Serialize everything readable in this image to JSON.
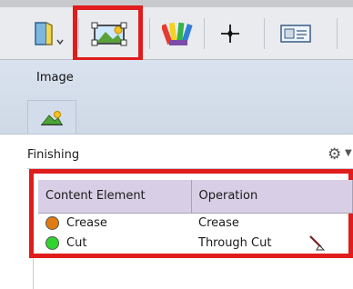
{
  "toolbar": {
    "tools": [
      {
        "icon": "document-flip-icon"
      },
      {
        "icon": "image-frame-icon",
        "selected": true
      },
      {
        "icon": "color-swatches-icon"
      },
      {
        "icon": "crosshair-icon"
      },
      {
        "icon": "layout-view-icon"
      }
    ]
  },
  "image_panel": {
    "label": "Image",
    "tab_icon": "image-icon"
  },
  "finishing": {
    "title": "Finishing",
    "gear_icon": "gear-icon",
    "columns": [
      "Content Element",
      "Operation"
    ],
    "rows": [
      {
        "element": "Crease",
        "operation": "Crease",
        "color": "#e07b11"
      },
      {
        "element": "Cut",
        "operation": "Through Cut",
        "color": "#2fd42f",
        "tool_icon": "knife-icon"
      }
    ]
  },
  "colors": {
    "highlight": "#e01c1c",
    "header_bg": "#d8cfe6",
    "panel_bg": "#d9e2ee"
  }
}
